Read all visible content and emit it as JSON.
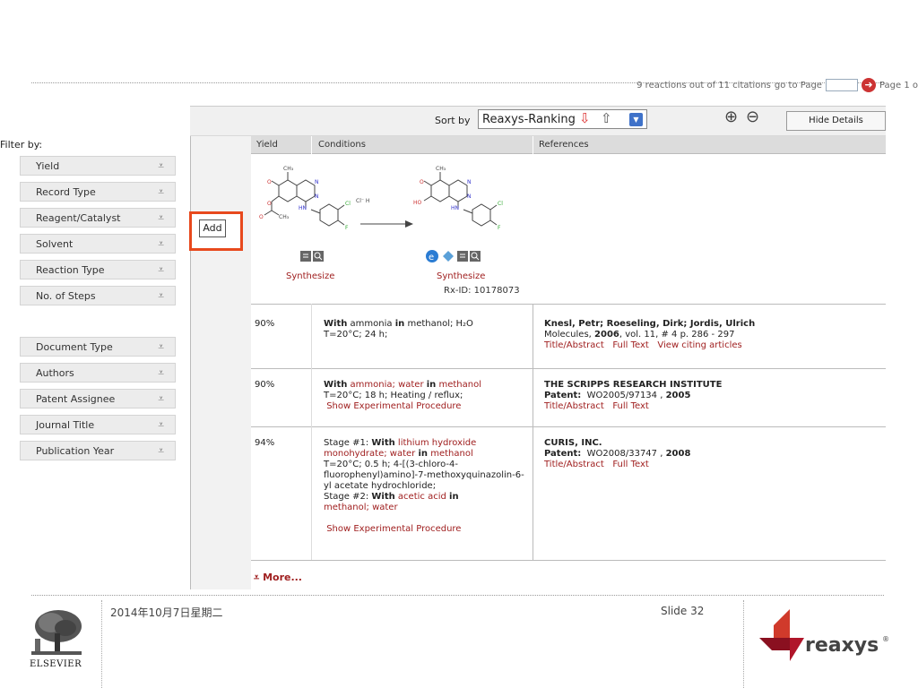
{
  "top_bar": {
    "status": "9 reactions out of 11 citations",
    "goto_label": "go to Page",
    "page_label": "Page 1 o"
  },
  "toolbar": {
    "sort_label": "Sort by",
    "sort_value": "Reaxys-Ranking",
    "hide_details": "Hide Details"
  },
  "filter": {
    "title": "Filter by:",
    "groups": [
      "Yield",
      "Record Type",
      "Reagent/Catalyst",
      "Solvent",
      "Reaction Type",
      "No. of Steps",
      "Document Type",
      "Authors",
      "Patent Assignee",
      "Journal Title",
      "Publication Year"
    ]
  },
  "add_button": "Add",
  "columns": {
    "yield": "Yield",
    "conditions": "Conditions",
    "references": "References"
  },
  "scheme": {
    "left_synthesize": "Synthesize",
    "right_synthesize": "Synthesize",
    "rx_id": "Rx-ID: 10178073",
    "hcl_label": "Cl⁻ H"
  },
  "rows": [
    {
      "yield": "90%",
      "cond_with": "With",
      "cond_reagent": "ammonia",
      "cond_in": "in",
      "cond_solvent": "methanol; H₂O",
      "cond_line2": "T=20°C; 24 h;",
      "ref_authors": "Knesl, Petr; Roeseling, Dirk; Jordis, Ulrich",
      "ref_journal": "Molecules,",
      "ref_year": "2006",
      "ref_details": ", vol. 11, # 4  p. 286 - 297",
      "links": [
        "Title/Abstract",
        "Full Text",
        "View citing articles"
      ]
    },
    {
      "yield": "90%",
      "cond_with": "With",
      "cond_reagent": "ammonia; water",
      "cond_in": "in",
      "cond_solvent": "methanol",
      "cond_line2": "T=20°C; 18 h; Heating / reflux;",
      "show_exp": "Show Experimental Procedure",
      "ref_authors": "THE SCRIPPS RESEARCH INSTITUTE",
      "ref_patent_label": "Patent:",
      "ref_patent": "WO2005/97134 ,",
      "ref_year": "2005",
      "links": [
        "Title/Abstract",
        "Full Text"
      ]
    },
    {
      "yield": "94%",
      "stage1_label": "Stage #1:",
      "stage1_with": "With",
      "stage1_reagent": "lithium hydroxide monohydrate; water",
      "stage1_in": "in",
      "stage1_solvent": "methanol",
      "stage1_rest": "T=20°C; 0.5 h; 4-[(3-chloro-4-fluorophenyl)amino]-7-methoxyquinazolin-6-yl acetate hydrochloride;",
      "stage2_label": "Stage #2:",
      "stage2_with": "With",
      "stage2_reagent": "acetic acid",
      "stage2_in": "in",
      "stage2_solvent": "methanol; water",
      "show_exp": "Show Experimental Procedure",
      "ref_authors": "CURIS, INC.",
      "ref_patent_label": "Patent:",
      "ref_patent": "WO2008/33747 ,",
      "ref_year": "2008",
      "links": [
        "Title/Abstract",
        "Full Text"
      ]
    }
  ],
  "more": "More...",
  "footer": {
    "date": "2014年10月7日星期二",
    "slide": "Slide 32",
    "elsevier": "ELSEVIER",
    "reaxys": "reaxys",
    "reg": "®"
  },
  "colors": {
    "accent": "#e8491d",
    "link": "#a02020",
    "reaxys_red": "#c8102e"
  },
  "icons": [
    "zoom-in-icon",
    "zoom-out-icon",
    "sort-down-icon",
    "sort-up-icon",
    "expand-chevron-icon",
    "text-icon",
    "magnify-icon",
    "e-icon",
    "diamond-icon",
    "go-arrow-icon"
  ]
}
